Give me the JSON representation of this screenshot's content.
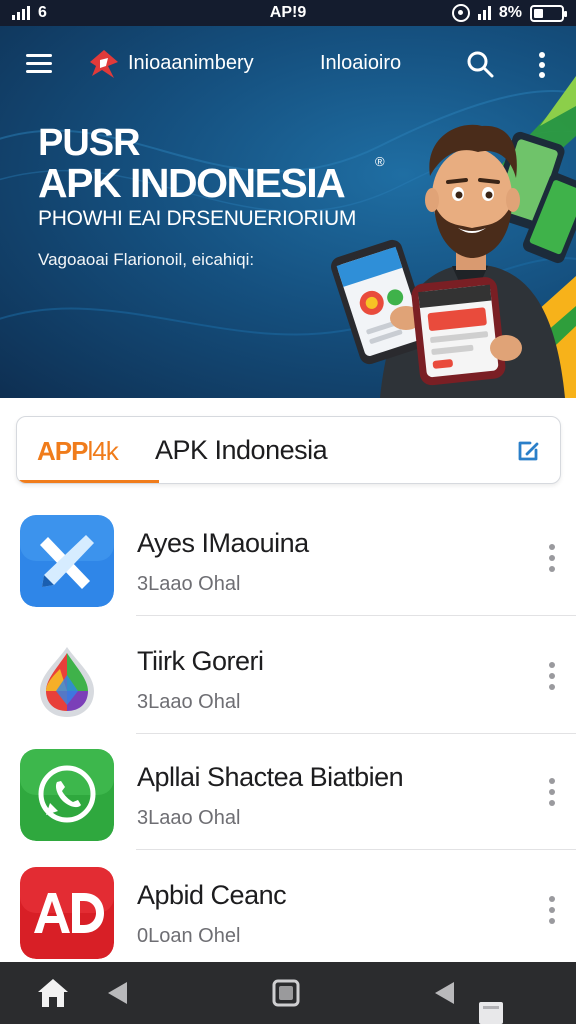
{
  "status_bar": {
    "left_text": "6",
    "center_text": "AP!9",
    "battery_text": "8%"
  },
  "header": {
    "brand_name": "Inioaanimbery",
    "nav_link": "Inloaioiro"
  },
  "hero": {
    "kicker": "PUSR",
    "title": "APK INDONESIA",
    "registered_mark": "®",
    "subtitle": "PHOWHI EAI DRSENUERIORIUM",
    "description": "Vagoaoai Flarionoil, eicahiqi:"
  },
  "search": {
    "prefix_bold": "APP",
    "prefix_rest": "l4k",
    "value": "APK Indonesia"
  },
  "apps": [
    {
      "name": "Ayes IMaouina",
      "meta": "3Laao Ohal",
      "icon": "blue-tools-app-icon"
    },
    {
      "name": "Tiirk Goreri",
      "meta": "3Laao Ohal",
      "icon": "colorful-drop-app-icon"
    },
    {
      "name": "Apllai Shactea Biatbien",
      "meta": "3Laao Ohal",
      "icon": "whatsapp-phone-app-icon"
    },
    {
      "name": "Apbid Ceanc",
      "meta": "0Loan Ohel",
      "icon": "red-ad-app-icon"
    }
  ],
  "colors": {
    "accent": "#f07c1b",
    "hero_dark": "#0e2f52",
    "hero_mid": "#15507f",
    "nav_bar": "#2b2c2e"
  }
}
